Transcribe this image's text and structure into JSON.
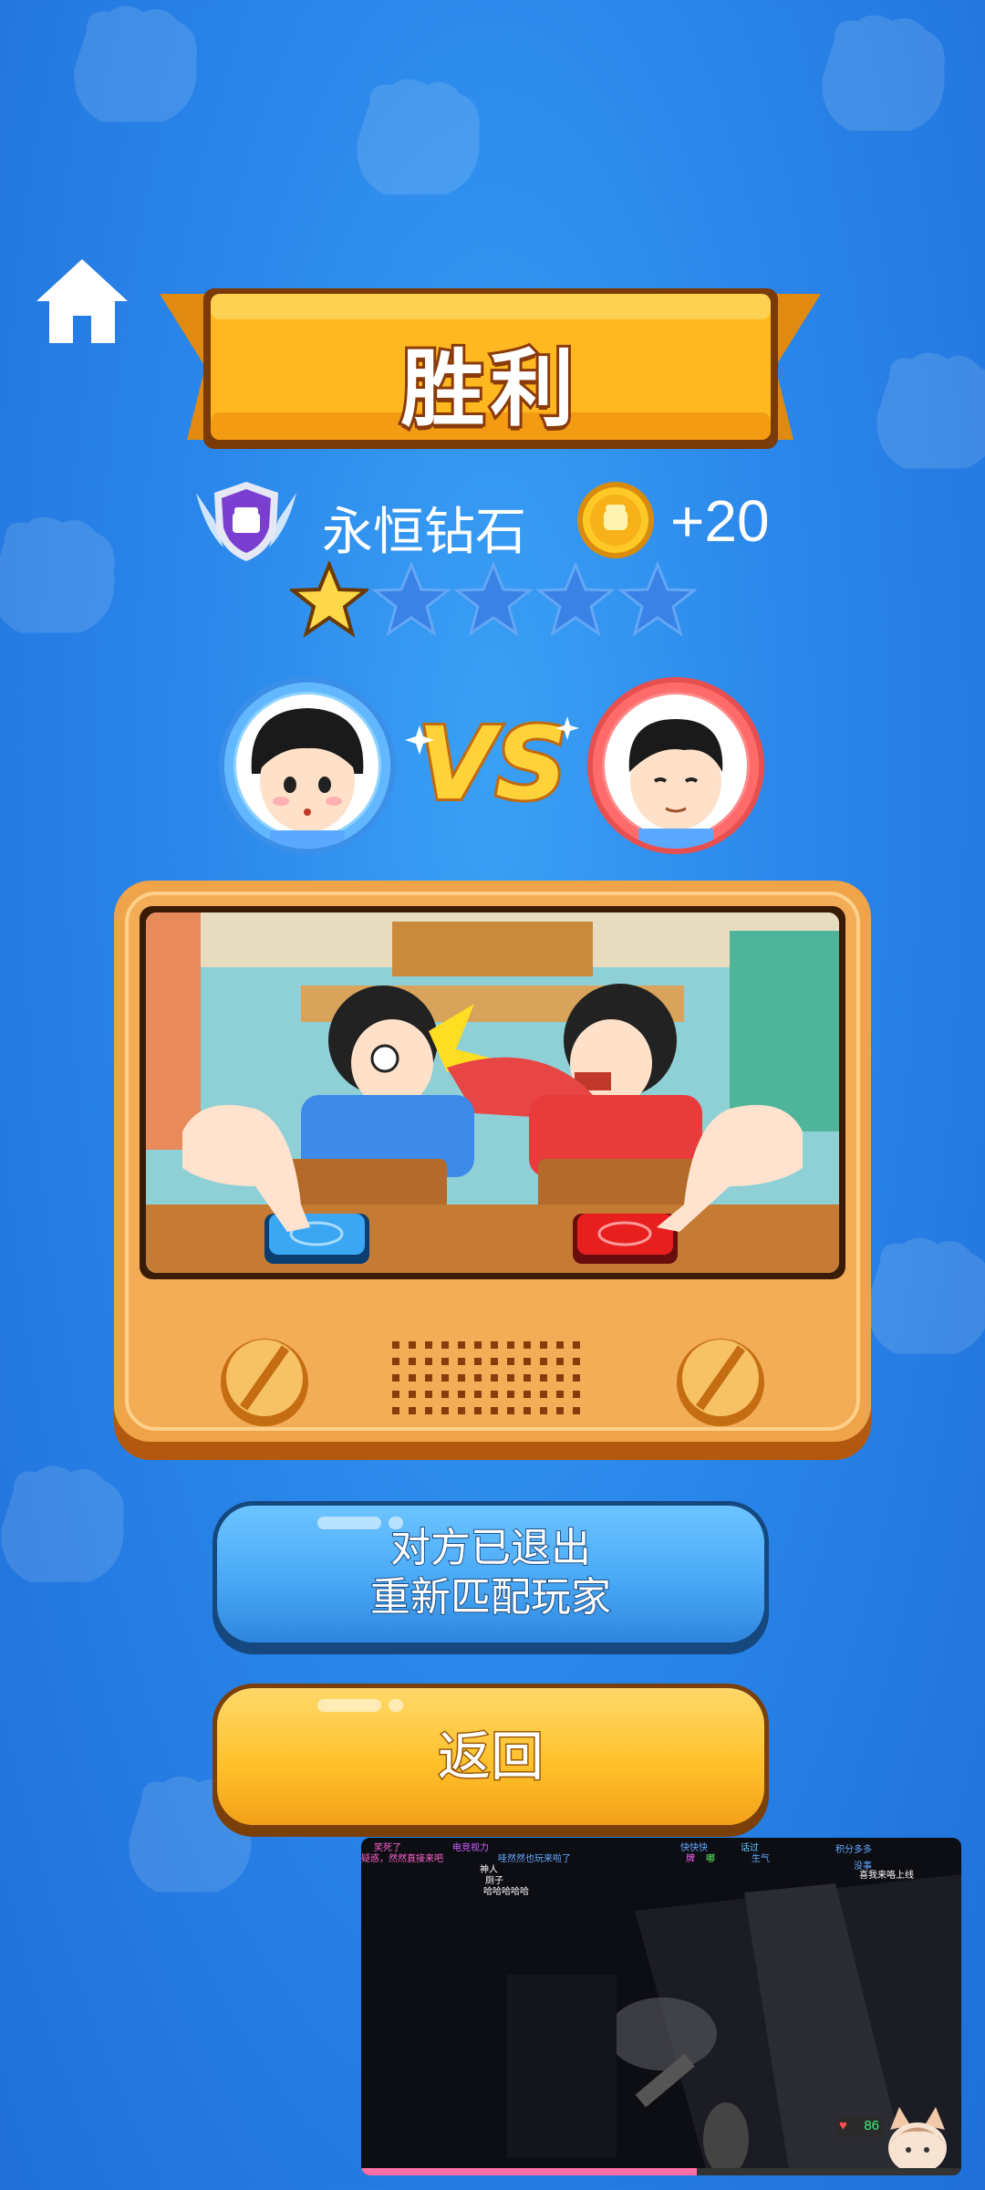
{
  "header": {
    "title": "胜利",
    "home_icon": "home-icon"
  },
  "rank": {
    "tier_name": "永恒钻石",
    "badge_icon": "diamond-rank-badge-icon",
    "coin_icon": "fist-coin-icon",
    "coin_reward": "+20",
    "stars_filled": 1,
    "stars_total": 5
  },
  "match": {
    "vs_label": "VS",
    "player_left": "girl-avatar",
    "player_right": "boy-avatar",
    "scene": "classroom-punch-scene"
  },
  "buttons": {
    "rematch_line1": "对方已退出",
    "rematch_line2": "重新匹配玩家",
    "back_label": "返回"
  },
  "stream_overlay": {
    "danmu": [
      {
        "text": "笑死了",
        "color": "#ff66cc"
      },
      {
        "text": "电竞视力",
        "color": "#cc66ff"
      },
      {
        "text": "快快快",
        "color": "#66aaff"
      },
      {
        "text": "话过",
        "color": "#66ccff"
      },
      {
        "text": "哪",
        "color": "#66ff66"
      },
      {
        "text": "积分多多",
        "color": "#66aaff"
      },
      {
        "text": "疑惑，然然直接来吧",
        "color": "#ff66cc"
      },
      {
        "text": "哇然然也玩来啦了",
        "color": "#66aaff"
      },
      {
        "text": "牌",
        "color": "#ff66ff"
      },
      {
        "text": "生气",
        "color": "#66aaff"
      },
      {
        "text": "没事",
        "color": "#66aaff"
      },
      {
        "text": "神人",
        "color": "#ffffff"
      },
      {
        "text": "喜我来咯上线",
        "color": "#ffffff"
      },
      {
        "text": "厕子",
        "color": "#ffffff"
      },
      {
        "text": "哈哈哈哈哈",
        "color": "#ffffff"
      }
    ],
    "health": "86",
    "progress": 0.56
  },
  "colors": {
    "background": "#2a86ea",
    "banner": "#ffb81f",
    "rematch_button": "#49a9f6",
    "back_button": "#ffc12b"
  }
}
